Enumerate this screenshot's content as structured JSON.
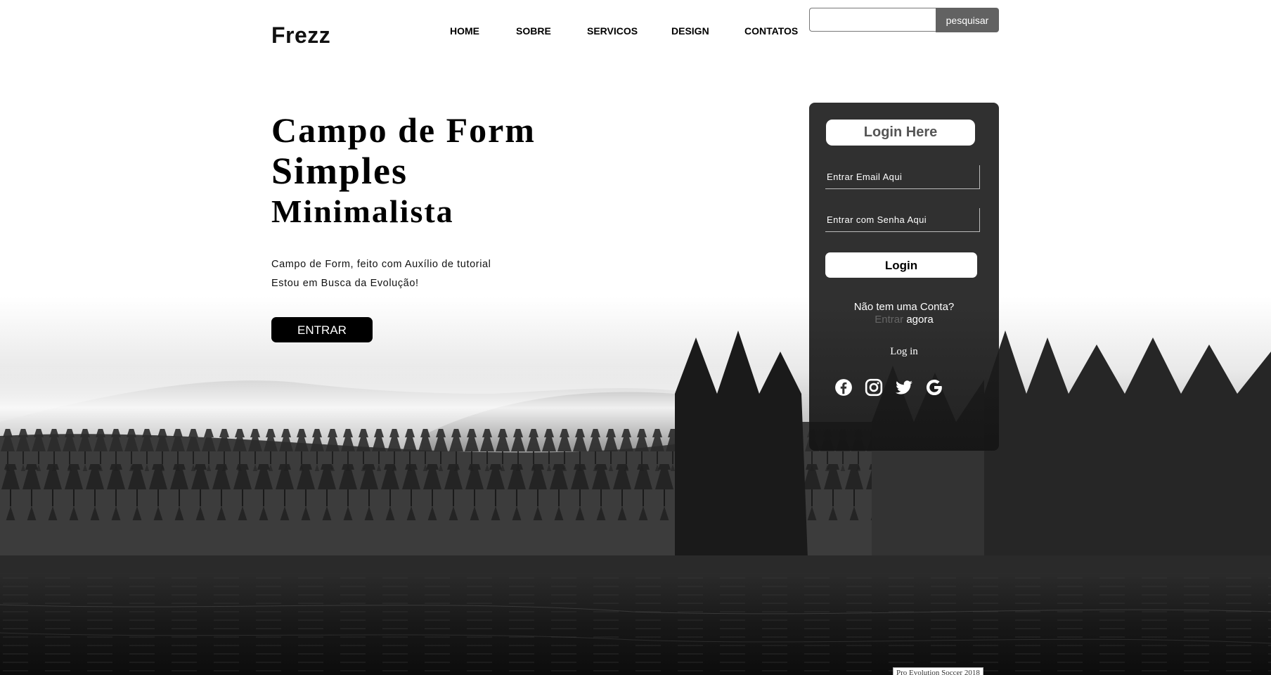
{
  "header": {
    "logo": "Frezz",
    "nav": [
      "HOME",
      "SOBRE",
      "SERVICOS",
      "DESIGN",
      "CONTATOS"
    ],
    "search": {
      "value": "",
      "placeholder": "",
      "button_label": "pesquisar"
    }
  },
  "hero": {
    "title_lines": [
      "Campo de Form",
      "Simples",
      "Minimalista"
    ],
    "description_lines": [
      "Campo de Form, feito com Auxílio de tutorial",
      "Estou em Busca da Evolução!"
    ],
    "cta_label": "ENTRAR"
  },
  "login_card": {
    "heading": "Login Here",
    "email_placeholder": "Entrar Email Aqui",
    "password_placeholder": "Entrar com Senha Aqui",
    "login_button": "Login",
    "signup_prompt": "Não tem uma Conta?",
    "signup_link": "Entrar",
    "signup_suffix": "agora",
    "login_link": "Log in",
    "social_icons": [
      "facebook-icon",
      "instagram-icon",
      "twitter-icon",
      "google-icon"
    ]
  },
  "tooltip": "Pro Evolution Soccer 2018",
  "colors": {
    "card_background": "#303030",
    "search_button": "#626262",
    "cta_background": "#000000",
    "signup_link": "#666666"
  }
}
